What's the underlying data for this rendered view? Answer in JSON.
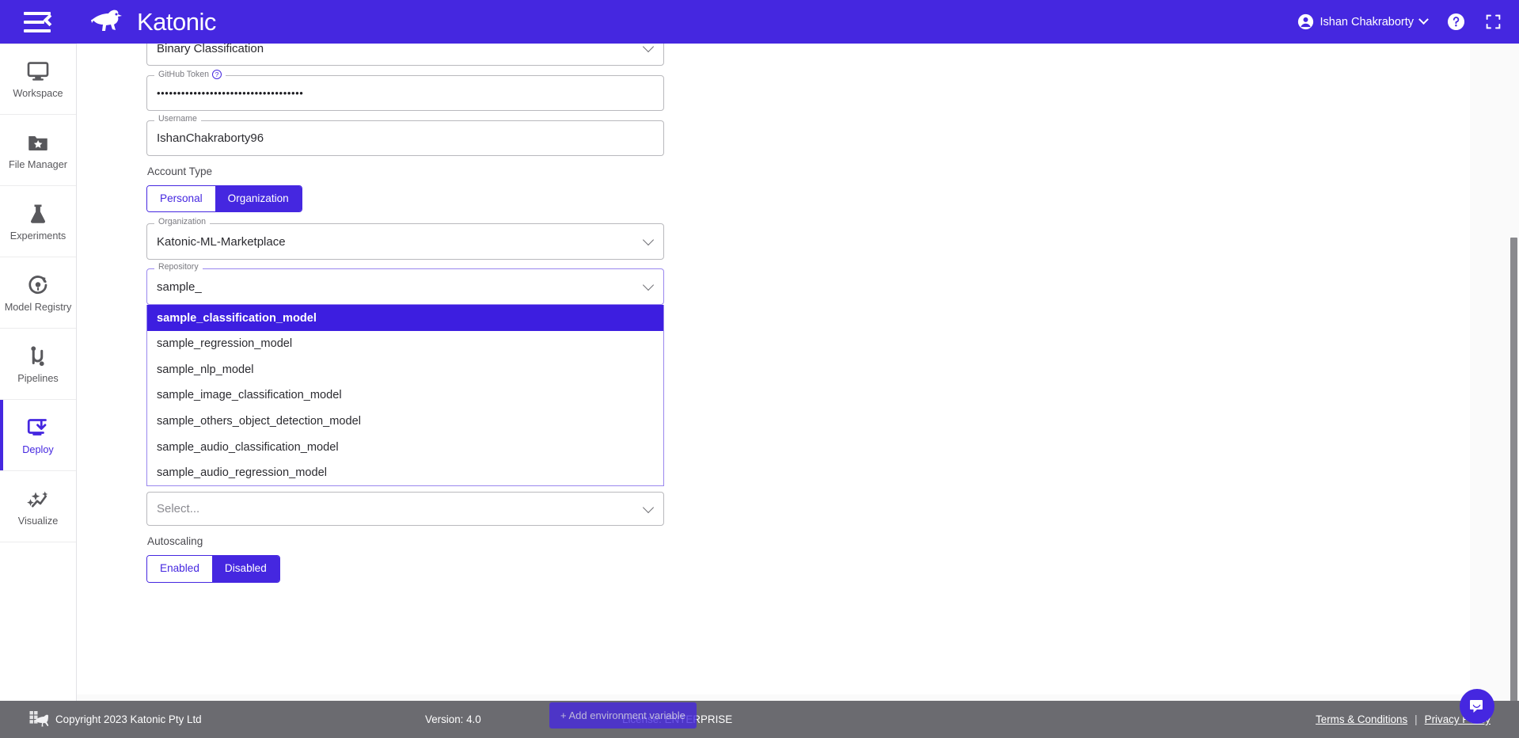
{
  "header": {
    "brand_name": "Katonic",
    "user_name": "Ishan Chakraborty",
    "menu_icon": "hamburger-icon",
    "help_icon": "help-circle-icon",
    "fullscreen_icon": "fullscreen-expand-icon"
  },
  "sidebar": {
    "items": [
      {
        "label": "Workspace",
        "icon": "monitor-icon",
        "active": false
      },
      {
        "label": "File Manager",
        "icon": "folder-star-icon",
        "active": false
      },
      {
        "label": "Experiments",
        "icon": "flask-icon",
        "active": false
      },
      {
        "label": "Model Registry",
        "icon": "model-refresh-icon",
        "active": false
      },
      {
        "label": "Pipelines",
        "icon": "pipeline-icon",
        "active": false
      },
      {
        "label": "Deploy",
        "icon": "deploy-download-icon",
        "active": true
      },
      {
        "label": "Visualize",
        "icon": "sparkle-chart-icon",
        "active": false
      }
    ]
  },
  "form": {
    "model_type": {
      "value": "Binary Classification"
    },
    "github_token": {
      "label": "GitHub Token",
      "value": "••••••••••••••••••••••••••••••••••••"
    },
    "username": {
      "label": "Username",
      "value": "IshanChakraborty96"
    },
    "account_type": {
      "label": "Account Type",
      "options": [
        "Personal",
        "Organization"
      ],
      "selected": "Organization"
    },
    "organization": {
      "label": "Organization",
      "value": "Katonic-ML-Marketplace"
    },
    "repository": {
      "label": "Repository",
      "value": "sample_",
      "options": [
        "sample_classification_model",
        "sample_regression_model",
        "sample_nlp_model",
        "sample_image_classification_model",
        "sample_others_object_detection_model",
        "sample_audio_classification_model",
        "sample_audio_regression_model"
      ],
      "highlighted_index": 0
    },
    "branch_select": {
      "placeholder": "Select..."
    },
    "autoscaling": {
      "label": "Autoscaling",
      "options": [
        "Enabled",
        "Disabled"
      ],
      "selected": "Disabled"
    },
    "add_env_var_label": "+ Add environment variable"
  },
  "footer": {
    "copyright": "Copyright 2023 Katonic Pty Ltd",
    "version": "Version: 4.0",
    "license": "License: ENTERPRISE",
    "terms_label": "Terms & Conditions",
    "separator": "|",
    "privacy_label": "Privacy Policy"
  },
  "colors": {
    "brand_purple": "#4527e0",
    "highlight_purple": "#3d1ee0",
    "footer_gray": "#6b6b70",
    "focus_border": "#9a87ee"
  }
}
